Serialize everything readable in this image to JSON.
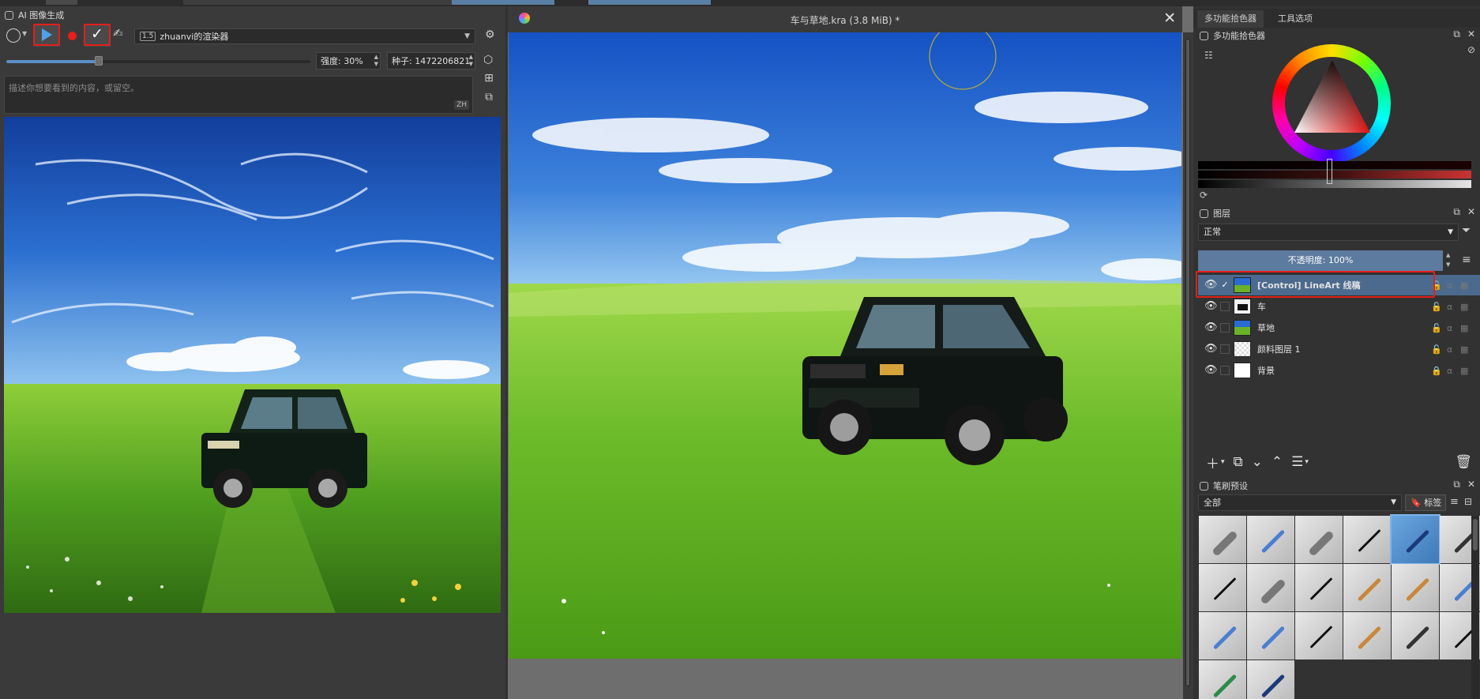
{
  "ai_panel": {
    "title": "AI 图像生成",
    "model": "zhuanvi的渲染器",
    "model_badge": "1.5",
    "strength_label": "强度: 30%",
    "strength_value": 0.3,
    "seed_label": "种子: 1472206821",
    "prompt_placeholder": "描述你想要看到的内容，或留空。",
    "lang_button": "ZH"
  },
  "document": {
    "title": "车与草地.kra (3.8 MiB) *",
    "close_glyph": "✕"
  },
  "right_panel": {
    "tabs": [
      "多功能拾色器",
      "工具选项"
    ],
    "color_selector_title": "多功能拾色器",
    "layers_title": "图层",
    "blend_mode": "正常",
    "opacity_label": "不透明度:  100%",
    "layers": [
      {
        "name": "[Control] LineArt 线稿",
        "selected": true,
        "checked": true
      },
      {
        "name": "车",
        "selected": false,
        "checked": false
      },
      {
        "name": "草地",
        "selected": false,
        "checked": false
      },
      {
        "name": "颜料图层 1",
        "selected": false,
        "checked": false
      },
      {
        "name": "背景",
        "selected": false,
        "checked": false,
        "locked": true
      }
    ],
    "brush_presets_title": "笔刷预设",
    "brush_filter": "全部",
    "tag_button": "标签"
  },
  "colors": {
    "accent_blue": "#5b8ec4",
    "selection": "#4b6a8e",
    "highlight_red": "#e3201a"
  }
}
